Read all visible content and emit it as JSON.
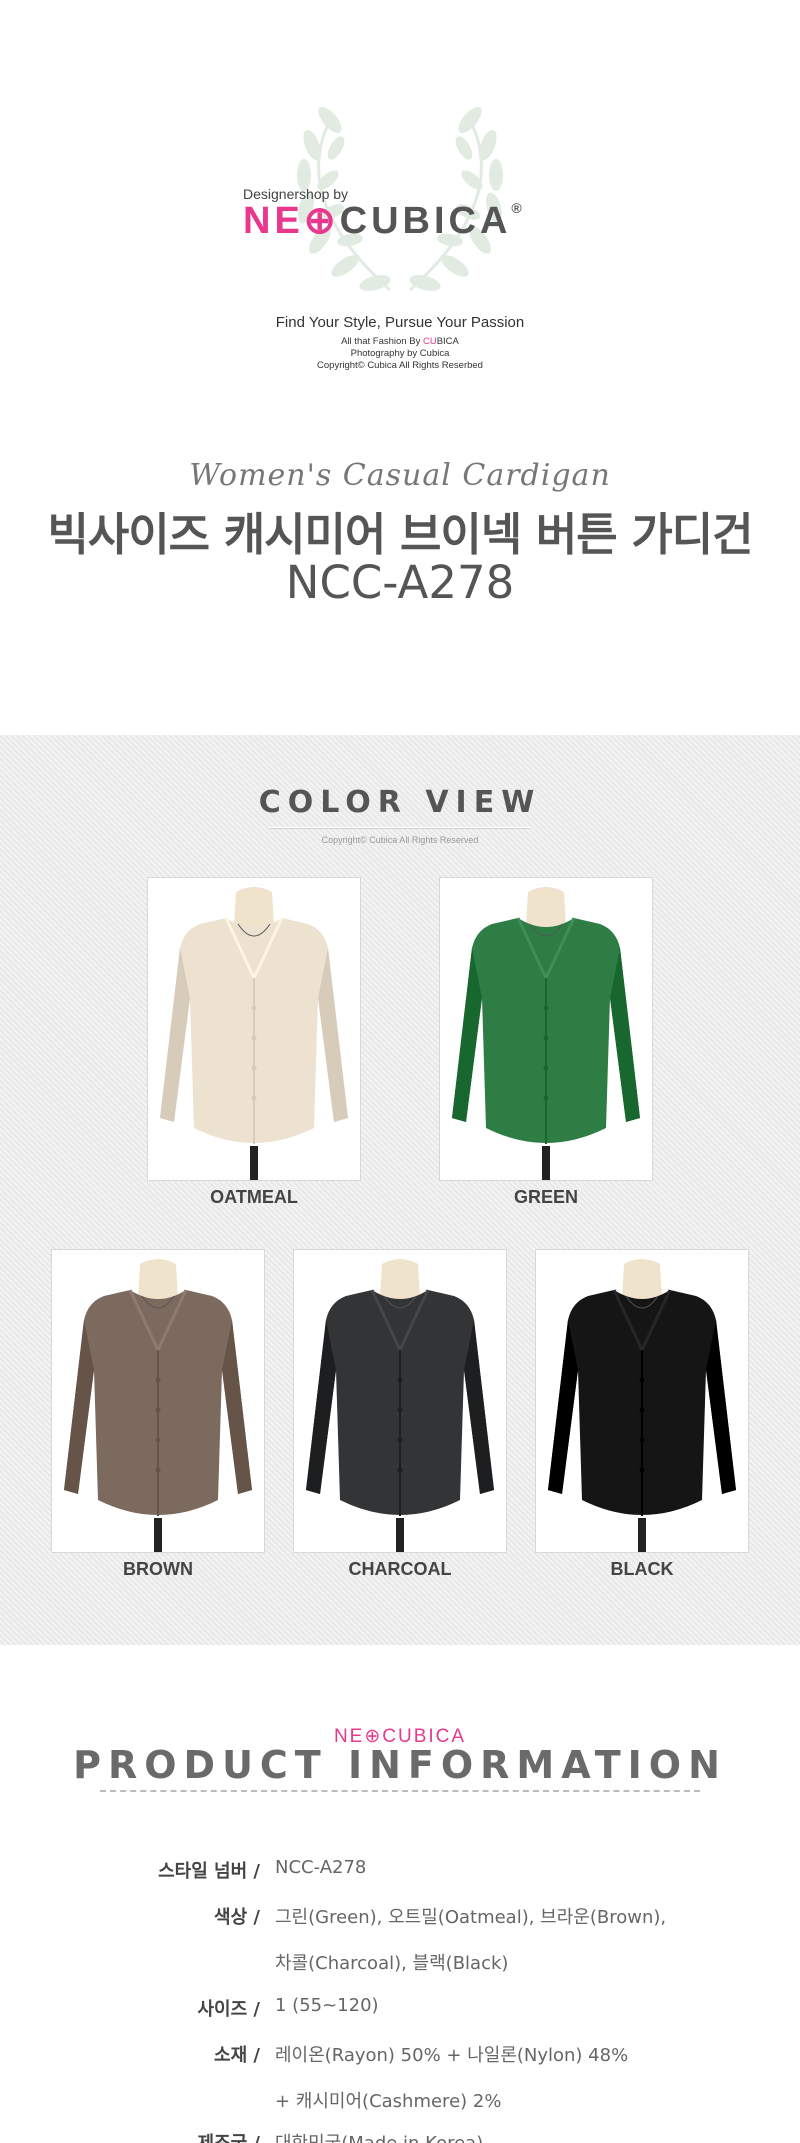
{
  "header": {
    "designershop": "Designershop by",
    "logo_neo": "NE⊕",
    "logo_cubica": "CUBICA",
    "logo_reg": "®",
    "tagline": "Find Your Style, Pursue Your Passion",
    "fashion_prefix": "All that Fashion By ",
    "fashion_brand_cu": "CU",
    "fashion_brand_rest": "BICA",
    "photography": "Photography by Cubica",
    "copyright": "Copyright© Cubica All Rights Reserbed"
  },
  "product": {
    "script_title": "Women's Casual Cardigan",
    "title": "빅사이즈 캐시미어 브이넥 버튼 가디건",
    "code": "NCC-A278"
  },
  "color_view": {
    "title": "COLOR VIEW",
    "copyright": "Copyright© Cubica All Rights Reserved",
    "colors": [
      {
        "name": "OATMEAL",
        "hex": "#ece2cf"
      },
      {
        "name": "GREEN",
        "hex": "#2e7d45"
      },
      {
        "name": "BROWN",
        "hex": "#7c6a5f"
      },
      {
        "name": "CHARCOAL",
        "hex": "#333436"
      },
      {
        "name": "BLACK",
        "hex": "#151515"
      }
    ]
  },
  "product_info": {
    "brand": "NE⊕CUBICA",
    "title": "PRODUCT INFORMATION",
    "rows": [
      {
        "label": "스타일 넘버 /",
        "value": "NCC-A278"
      },
      {
        "label": "색상 /",
        "value": "그린(Green), 오트밀(Oatmeal), 브라운(Brown),"
      },
      {
        "label": "",
        "value": "차콜(Charcoal), 블랙(Black)"
      },
      {
        "label": "사이즈 /",
        "value": "1 (55~120)"
      },
      {
        "label": "소재 /",
        "value": "레이온(Rayon) 50% + 나일론(Nylon) 48%"
      },
      {
        "label": "",
        "value": "+  캐시미어(Cashmere) 2%"
      },
      {
        "label": "제조국 /",
        "value": "대한민국(Made in Korea)"
      }
    ]
  }
}
